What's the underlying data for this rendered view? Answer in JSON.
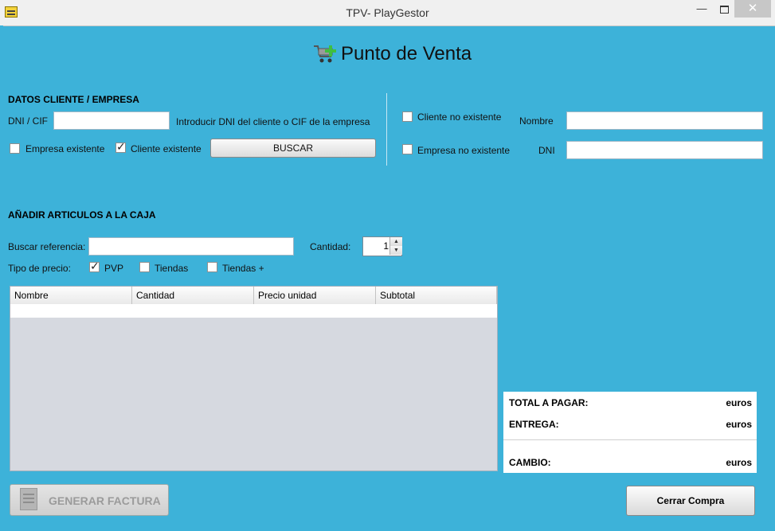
{
  "window": {
    "title": "TPV- PlayGestor",
    "min_label": "—",
    "close_label": "✕"
  },
  "header": {
    "title": "Punto de Venta",
    "icon": "shopping-cart-add-icon"
  },
  "client": {
    "section_title": "DATOS CLIENTE / EMPRESA",
    "dni_label": "DNI / CIF",
    "dni_value": "",
    "hint": "Introducir DNI  del cliente o CIF de la empresa",
    "empresa_existente_label": "Empresa existente",
    "empresa_existente_checked": false,
    "cliente_existente_label": "Cliente existente",
    "cliente_existente_checked": true,
    "search_button": "BUSCAR",
    "cliente_no_existente_label": "Cliente no existente",
    "cliente_no_existente_checked": false,
    "empresa_no_existente_label": "Empresa no existente",
    "empresa_no_existente_checked": false,
    "nombre_label": "Nombre",
    "nombre_value": "",
    "dni2_label": "DNI",
    "dni2_value": ""
  },
  "articles": {
    "section_title": "AÑADIR ARTICULOS A LA CAJA",
    "search_label": "Buscar referencia:",
    "search_value": "",
    "quantity_label": "Cantidad:",
    "quantity_value": "1",
    "price_type_label": "Tipo de precio:",
    "price_types": [
      {
        "label": "PVP",
        "checked": true
      },
      {
        "label": "Tiendas",
        "checked": false
      },
      {
        "label": "Tiendas +",
        "checked": false
      }
    ]
  },
  "table": {
    "columns": [
      "Nombre",
      "Cantidad",
      "Precio unidad",
      "Subtotal"
    ],
    "rows": []
  },
  "totals": {
    "total_label": "TOTAL A PAGAR:",
    "total_value": "",
    "entrega_label": "ENTREGA:",
    "entrega_value": "",
    "cambio_label": "CAMBIO:",
    "cambio_value": "",
    "unit": "euros"
  },
  "footer": {
    "generate_invoice": "GENERAR FACTURA",
    "close_purchase": "Cerrar Compra"
  },
  "colors": {
    "background": "#3db2d9",
    "panel": "#ffffff"
  }
}
